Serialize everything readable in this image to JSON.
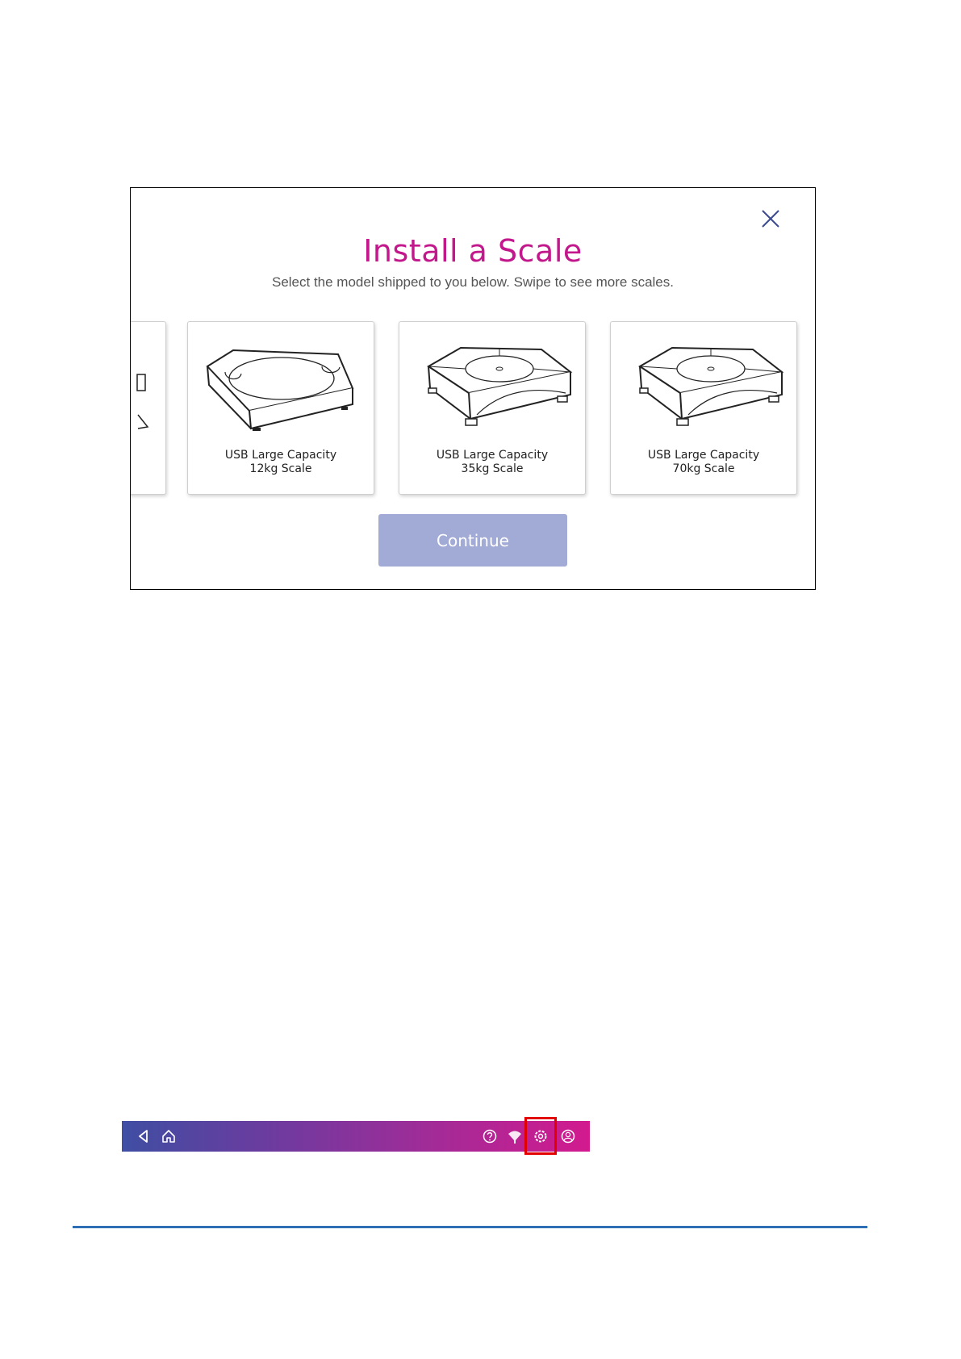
{
  "dialog": {
    "title": "Install a Scale",
    "subtitle": "Select the model shipped to you below. Swipe to see more scales.",
    "continue_label": "Continue"
  },
  "scales": [
    {
      "line1": "USB Large Capacity",
      "line2": "12kg Scale"
    },
    {
      "line1": "USB Large Capacity",
      "line2": "35kg Scale"
    },
    {
      "line1": "USB Large Capacity",
      "line2": "70kg Scale"
    }
  ],
  "navbar": {
    "icons": [
      "back-icon",
      "home-icon",
      "help-icon",
      "network-icon",
      "settings-icon",
      "account-icon"
    ],
    "highlighted": "settings-icon",
    "highlight_color": "#e20000"
  },
  "colors": {
    "title": "#c2188c",
    "continue_button": "#a2abd6",
    "rule": "#2e6fb3"
  }
}
